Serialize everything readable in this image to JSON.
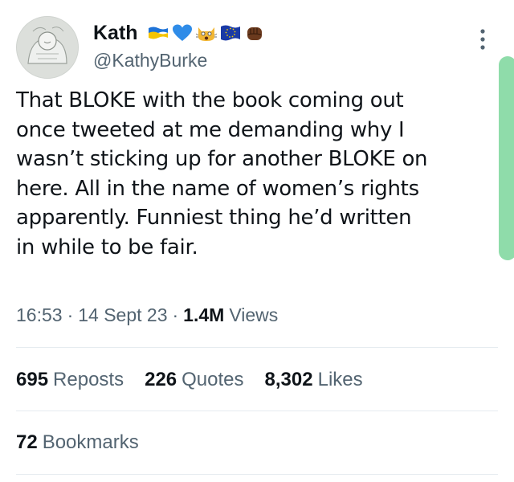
{
  "author": {
    "display_name": "Kath",
    "handle": "@KathyBurke",
    "avatar_icon": "sketch-avatar",
    "name_emojis": [
      "ukraine-flag-icon",
      "blue-heart-icon",
      "weary-cat-icon",
      "eu-flag-icon",
      "raised-fist-icon"
    ]
  },
  "tweet": {
    "text": "That BLOKE with the book coming out\nonce tweeted at me demanding why I\nwasn’t sticking up for another BLOKE on\nhere. All in the name of women’s rights\napparently. Funniest thing he’d written\nin while to be fair.",
    "time": "16:53",
    "date": "14 Sept 23",
    "separator": "·",
    "views_count": "1.4M",
    "views_label": "Views"
  },
  "stats": {
    "reposts": {
      "count": "695",
      "label": "Reposts"
    },
    "quotes": {
      "count": "226",
      "label": "Quotes"
    },
    "likes": {
      "count": "8,302",
      "label": "Likes"
    },
    "bookmarks": {
      "count": "72",
      "label": "Bookmarks"
    }
  },
  "colors": {
    "text_primary": "#0f1419",
    "text_secondary": "#536471",
    "divider": "#e6ecf0",
    "scroll_indicator": "#8fdcaa"
  }
}
